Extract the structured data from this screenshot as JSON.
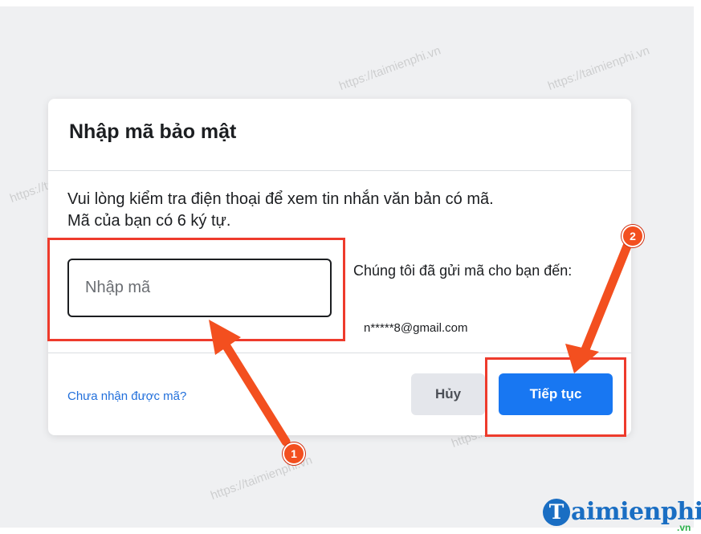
{
  "dialog": {
    "title": "Nhập mã bảo mật",
    "instructions_line1": "Vui lòng kiểm tra điện thoại để xem tin nhắn văn bản có mã.",
    "instructions_line2": "Mã của bạn có 6 ký tự.",
    "code_input": {
      "placeholder": "Nhập mã",
      "value": ""
    },
    "sent_info": "Chúng tôi đã gửi mã cho bạn đến:",
    "sent_email": "n*****8@gmail.com",
    "resend_link": "Chưa nhận được mã?",
    "cancel_label": "Hủy",
    "continue_label": "Tiếp tục"
  },
  "annotations": {
    "step1": "1",
    "step2": "2",
    "highlight_color": "#ee3b2c",
    "arrow_color": "#f34f1f"
  },
  "watermark": {
    "text": "https://taimienphi.vn"
  },
  "brand": {
    "initial": "T",
    "name": "aimienphi",
    "suffix": ".vn"
  },
  "colors": {
    "primary": "#1877f2",
    "link": "#216fdb",
    "background": "#eff0f2"
  }
}
